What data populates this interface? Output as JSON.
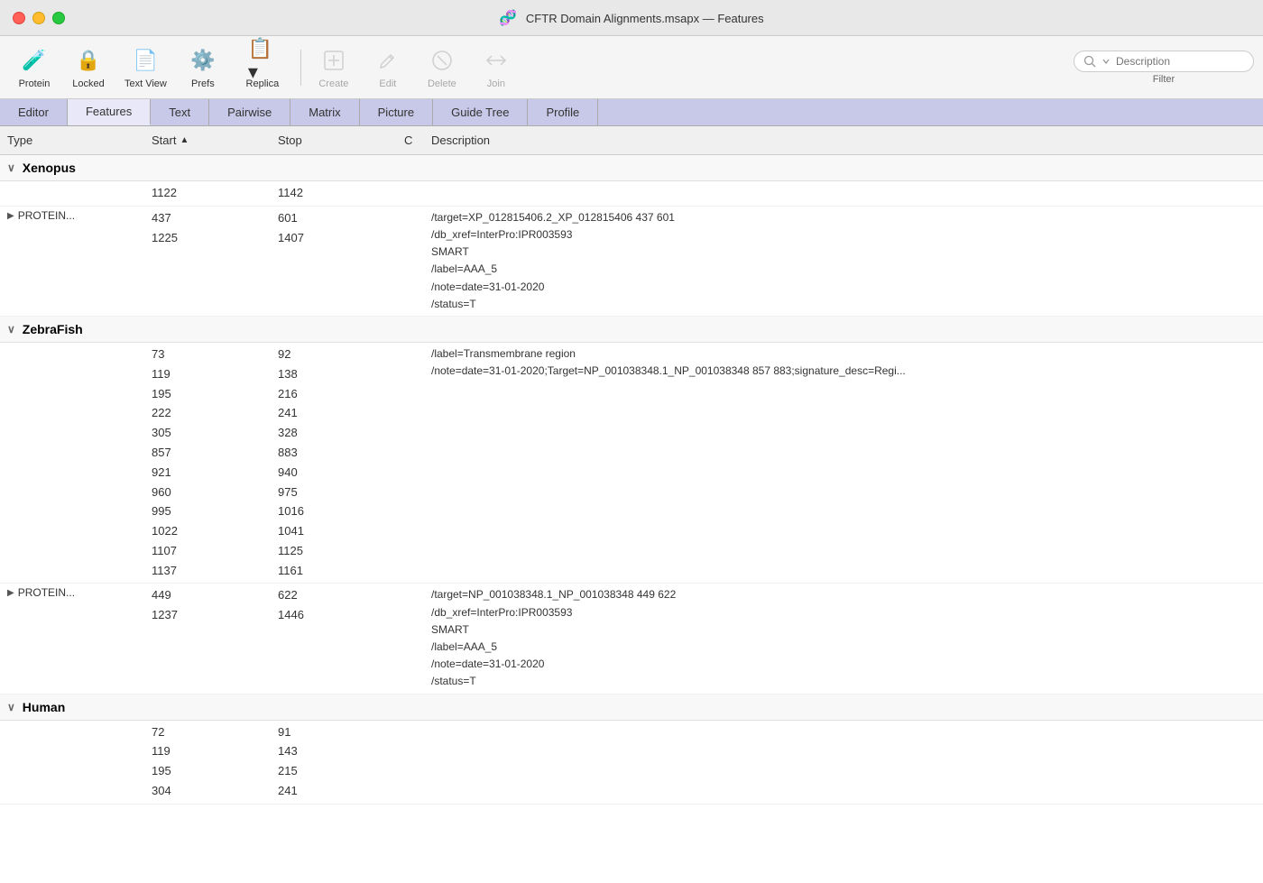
{
  "window": {
    "title": "CFTR Domain Alignments.msapx — Features",
    "icon": "🧬"
  },
  "toolbar": {
    "buttons": [
      {
        "id": "protein",
        "label": "Protein",
        "icon": "🧪",
        "disabled": false
      },
      {
        "id": "locked",
        "label": "Locked",
        "icon": "🔒",
        "disabled": false
      },
      {
        "id": "text-view",
        "label": "Text View",
        "icon": "📄",
        "disabled": false
      },
      {
        "id": "prefs",
        "label": "Prefs",
        "icon": "⚙️",
        "disabled": false
      },
      {
        "id": "replica",
        "label": "Replica",
        "icon": "📋",
        "disabled": false,
        "has_arrow": true
      },
      {
        "id": "create",
        "label": "Create",
        "icon": "➕",
        "disabled": true
      },
      {
        "id": "edit",
        "label": "Edit",
        "icon": "✏️",
        "disabled": true
      },
      {
        "id": "delete",
        "label": "Delete",
        "icon": "🚫",
        "disabled": true
      },
      {
        "id": "join",
        "label": "Join",
        "icon": "⟺",
        "disabled": true
      }
    ],
    "search_placeholder": "Description",
    "filter_label": "Filter"
  },
  "tabs": [
    {
      "id": "editor",
      "label": "Editor",
      "active": false
    },
    {
      "id": "features",
      "label": "Features",
      "active": true
    },
    {
      "id": "text",
      "label": "Text",
      "active": false
    },
    {
      "id": "pairwise",
      "label": "Pairwise",
      "active": false
    },
    {
      "id": "matrix",
      "label": "Matrix",
      "active": false
    },
    {
      "id": "picture",
      "label": "Picture",
      "active": false
    },
    {
      "id": "guide-tree",
      "label": "Guide Tree",
      "active": false
    },
    {
      "id": "profile",
      "label": "Profile",
      "active": false
    }
  ],
  "table": {
    "columns": [
      {
        "id": "type",
        "label": "Type"
      },
      {
        "id": "start",
        "label": "Start",
        "sortable": true,
        "sort_direction": "asc"
      },
      {
        "id": "stop",
        "label": "Stop"
      },
      {
        "id": "c",
        "label": "C"
      },
      {
        "id": "description",
        "label": "Description"
      }
    ]
  },
  "groups": [
    {
      "id": "xenopus",
      "name": "Xenopus",
      "collapsed": false,
      "rows": [
        {
          "type": "",
          "expandable": false,
          "starts": [
            "1122"
          ],
          "stops": [
            "1142"
          ],
          "description": ""
        },
        {
          "type": "PROTEIN...",
          "expandable": true,
          "starts": [
            "437",
            "1225"
          ],
          "stops": [
            "601",
            "1407"
          ],
          "description": "/target=XP_012815406.2_XP_012815406 437 601\n/db_xref=InterPro:IPR003593\nSMART\n/label=AAA_5\n/note=date=31-01-2020\n/status=T"
        }
      ]
    },
    {
      "id": "zebrafish",
      "name": "ZebraFish",
      "collapsed": false,
      "rows": [
        {
          "type": "",
          "expandable": false,
          "starts": [
            "73",
            "119",
            "195",
            "222",
            "305",
            "857",
            "921",
            "960",
            "995",
            "1022",
            "1107",
            "1137"
          ],
          "stops": [
            "92",
            "138",
            "216",
            "241",
            "328",
            "883",
            "940",
            "975",
            "1016",
            "1041",
            "1125",
            "1161"
          ],
          "description": "/label=Transmembrane region\n/note=date=31-01-2020;Target=NP_001038348.1_NP_001038348 857 883;signature_desc=Regi..."
        },
        {
          "type": "PROTEIN...",
          "expandable": true,
          "starts": [
            "449",
            "1237"
          ],
          "stops": [
            "622",
            "1446"
          ],
          "description": "/target=NP_001038348.1_NP_001038348 449 622\n/db_xref=InterPro:IPR003593\nSMART\n/label=AAA_5\n/note=date=31-01-2020\n/status=T"
        }
      ]
    },
    {
      "id": "human",
      "name": "Human",
      "collapsed": false,
      "rows": [
        {
          "type": "",
          "expandable": false,
          "starts": [
            "72",
            "119",
            "195",
            "304"
          ],
          "stops": [
            "91",
            "143",
            "215",
            "241"
          ],
          "description": ""
        }
      ]
    }
  ]
}
